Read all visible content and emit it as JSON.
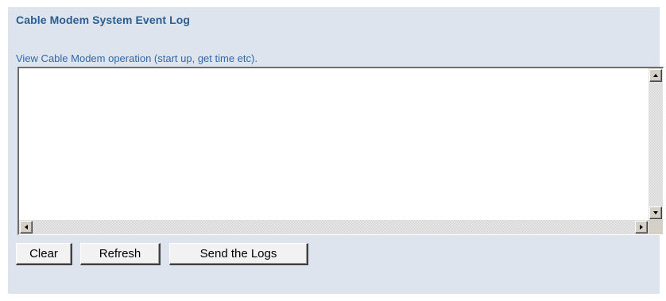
{
  "page": {
    "title": "Cable Modem System Event Log",
    "description": "View Cable Modem operation (start up, get time etc)."
  },
  "log": {
    "content": ""
  },
  "buttons": {
    "clear_label": "Clear",
    "refresh_label": "Refresh",
    "send_logs_label": "Send the Logs"
  },
  "icons": {
    "scroll_up": "triangle-up-icon",
    "scroll_down": "triangle-down-icon",
    "scroll_left": "triangle-left-icon",
    "scroll_right": "triangle-right-icon"
  },
  "colors": {
    "panel_background": "#dde4ee",
    "title_color": "#2b5d8f",
    "description_color": "#2f68a6"
  }
}
